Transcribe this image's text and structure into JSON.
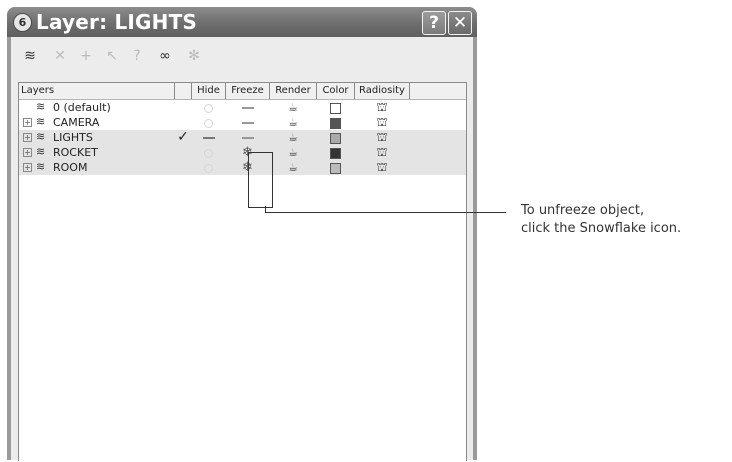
{
  "window": {
    "title": "Layer: LIGHTS",
    "app_icon": "swirl-icon",
    "help_label": "?",
    "close_label": "✕"
  },
  "toolbar": {
    "icons": [
      "new-layer-icon",
      "delete-icon",
      "add-selection-icon",
      "select-objects-icon",
      "help-icon",
      "hide-all-icon",
      "freeze-all-icon"
    ],
    "glyphs": [
      "≋",
      "✕",
      "+",
      "↖",
      "?",
      "∞",
      "✻"
    ]
  },
  "columns": {
    "layers": "Layers",
    "hide": "Hide",
    "freeze": "Freeze",
    "render": "Render",
    "color": "Color",
    "radiosity": "Radiosity"
  },
  "layers": [
    {
      "name": "0 (default)",
      "expandable": false,
      "current": false,
      "hide": "off",
      "freeze": "dash",
      "render": "teapot",
      "color": "#ffffff",
      "radiosity": "radiosity"
    },
    {
      "name": "CAMERA",
      "expandable": true,
      "current": false,
      "hide": "off",
      "freeze": "dash",
      "render": "teapot",
      "color": "#555555",
      "radiosity": "radiosity"
    },
    {
      "name": "LIGHTS",
      "expandable": true,
      "current": true,
      "hide": "off",
      "freeze": "dash",
      "render": "teapot",
      "color": "#aaaaaa",
      "radiosity": "radiosity"
    },
    {
      "name": "ROCKET",
      "expandable": true,
      "current": false,
      "hide": "off",
      "freeze": "snowflake",
      "render": "teapot",
      "color": "#333333",
      "radiosity": "radiosity"
    },
    {
      "name": "ROOM",
      "expandable": true,
      "current": false,
      "hide": "off",
      "freeze": "snowflake",
      "render": "teapot",
      "color": "#bbbbbb",
      "radiosity": "radiosity"
    }
  ],
  "glyphs": {
    "expander": "⊞",
    "layer_icon": "≋",
    "check": "✓",
    "teapot": "☕",
    "radiosity": "⛫",
    "snowflake": "❄"
  },
  "callout": {
    "line1": "To unfreeze object,",
    "line2": "click the Snowflake icon."
  }
}
